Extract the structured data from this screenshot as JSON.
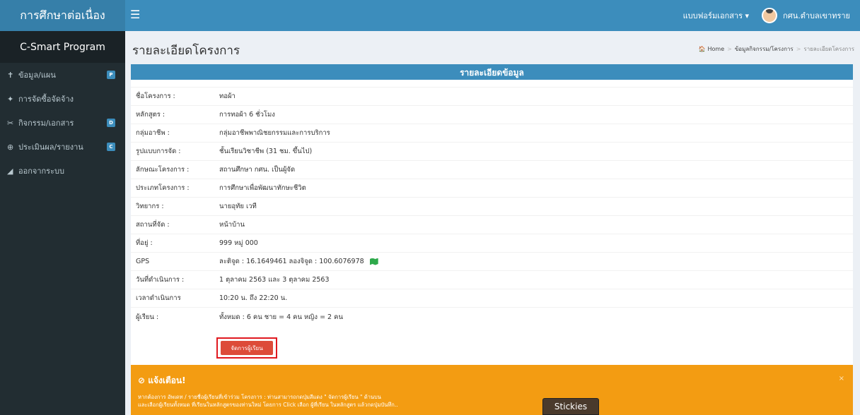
{
  "header": {
    "brand": "การศึกษาต่อเนื่อง",
    "menu_icon": "☰",
    "forms_menu": "แบบฟอร์มเอกสาร ▾",
    "user_name": "กศน.ตำบลเขาทราย"
  },
  "sidebar": {
    "title": "C-Smart Program",
    "items": [
      {
        "icon": "✝",
        "label": "ข้อมูล/แผน",
        "badge": "P"
      },
      {
        "icon": "✦",
        "label": "การจัดซื้อจัดจ้าง",
        "badge": ""
      },
      {
        "icon": "✂",
        "label": "กิจกรรม/เอกสาร",
        "badge": "D"
      },
      {
        "icon": "⊕",
        "label": "ประเมินผล/รายงาน",
        "badge": "C"
      },
      {
        "icon": "◢",
        "label": "ออกจากระบบ",
        "badge": ""
      }
    ]
  },
  "page": {
    "title": "รายละเอียดโครงการ",
    "breadcrumb": {
      "home": "Home",
      "parent": "ข้อมูลกิจกรรม/โครงการ",
      "current": "รายละเอียดโครงการ"
    }
  },
  "details": {
    "header": "รายละเอียดข้อมูล",
    "rows": [
      {
        "label": "ชื่อโครงการ :",
        "value": "ทอผ้า"
      },
      {
        "label": "หลักสูตร :",
        "value": "การทอผ้า 6 ชั่วโมง"
      },
      {
        "label": "กลุ่มอาชีพ :",
        "value": "กลุ่มอาชีพพาณิชยกรรมและการบริการ"
      },
      {
        "label": "รูปแบบการจัด :",
        "value": "ชั้นเรียนวิชาชีพ (31 ชม. ขึ้นไป)"
      },
      {
        "label": "ลักษณะโครงการ :",
        "value": "สถานศึกษา กศน. เป็นผู้จัด"
      },
      {
        "label": "ประเภทโครงการ :",
        "value": "การศึกษาเพื่อพัฒนาทักษะชีวิต"
      },
      {
        "label": "วิทยากร :",
        "value": "นายอุทัย เวที"
      },
      {
        "label": "สถานที่จัด :",
        "value": "หน้าบ้าน"
      },
      {
        "label": "ที่อยู่ :",
        "value": "999 หมู่ 000"
      },
      {
        "label": "GPS",
        "value": "ละติจูด : 16.1649461 ลองจิจูด : 100.6076978"
      },
      {
        "label": "วันที่ดำเนินการ :",
        "value": "1 ตุลาคม 2563 และ 3 ตุลาคม 2563"
      },
      {
        "label": "เวลาดำเนินการ",
        "value": "10:20 น. ถึง 22:20 น."
      },
      {
        "label": "ผู้เรียน :",
        "value": "ทั้งหมด : 6 คน ชาย = 4 คน หญิง = 2 คน"
      }
    ],
    "manage_button": "จัดการผู้เรียน"
  },
  "alert": {
    "title": "⊘ แจ้งเตือน!",
    "close": "×",
    "line1": "หากต้องการ อัพเดท / รายชื่อผู้เรียนที่เข้าร่วม โครงการ : ท่านสามารถกดปุ่มสีแดง \" จัดการผู้เรียน \" ด้านบน",
    "line2": "และเลือกผู้เรียนทั้งหมด ที่เรียนในหลักสูตรของท่านใหม่ โดยการ Click เลือก ผู้ที่เรียน ในหลักสูตร แล้วกดปุ่มบันทึก.."
  },
  "stickies": "Stickies"
}
